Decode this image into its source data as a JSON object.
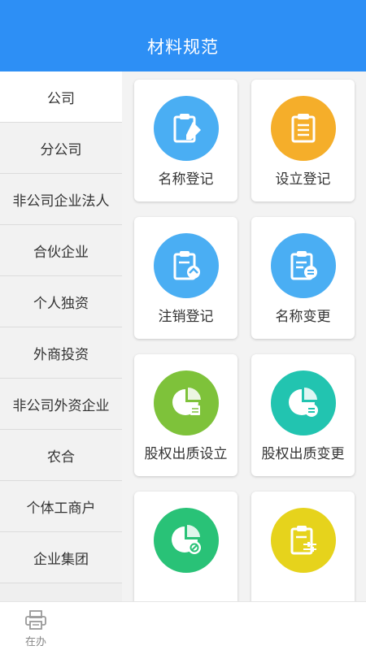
{
  "header": {
    "title": "材料规范"
  },
  "sidebar": {
    "items": [
      {
        "label": "公司",
        "active": true
      },
      {
        "label": "分公司"
      },
      {
        "label": "非公司企业法人"
      },
      {
        "label": "合伙企业"
      },
      {
        "label": "个人独资"
      },
      {
        "label": "外商投资"
      },
      {
        "label": "非公司外资企业"
      },
      {
        "label": "农合"
      },
      {
        "label": "个体工商户"
      },
      {
        "label": "企业集团"
      }
    ]
  },
  "grid": {
    "cards": [
      {
        "label": "名称登记",
        "icon": "clipboard-pen-icon",
        "color": "#4aaef3"
      },
      {
        "label": "设立登记",
        "icon": "clipboard-list-icon",
        "color": "#f5ae2a"
      },
      {
        "label": "注销登记",
        "icon": "clipboard-cancel-icon",
        "color": "#4aaef3"
      },
      {
        "label": "名称变更",
        "icon": "clipboard-exchange-icon",
        "color": "#4aaef3"
      },
      {
        "label": "股权出质设立",
        "icon": "pie-chart-doc-icon",
        "color": "#7ec23a"
      },
      {
        "label": "股权出质变更",
        "icon": "pie-chart-exchange-icon",
        "color": "#22c4b0"
      },
      {
        "label": "",
        "icon": "pie-chart-cancel-icon",
        "color": "#29c277"
      },
      {
        "label": "",
        "icon": "clipboard-sliders-icon",
        "color": "#e6d31c"
      }
    ]
  },
  "tabbar": {
    "items": [
      {
        "label": "在办",
        "icon": "printer-icon"
      }
    ]
  }
}
